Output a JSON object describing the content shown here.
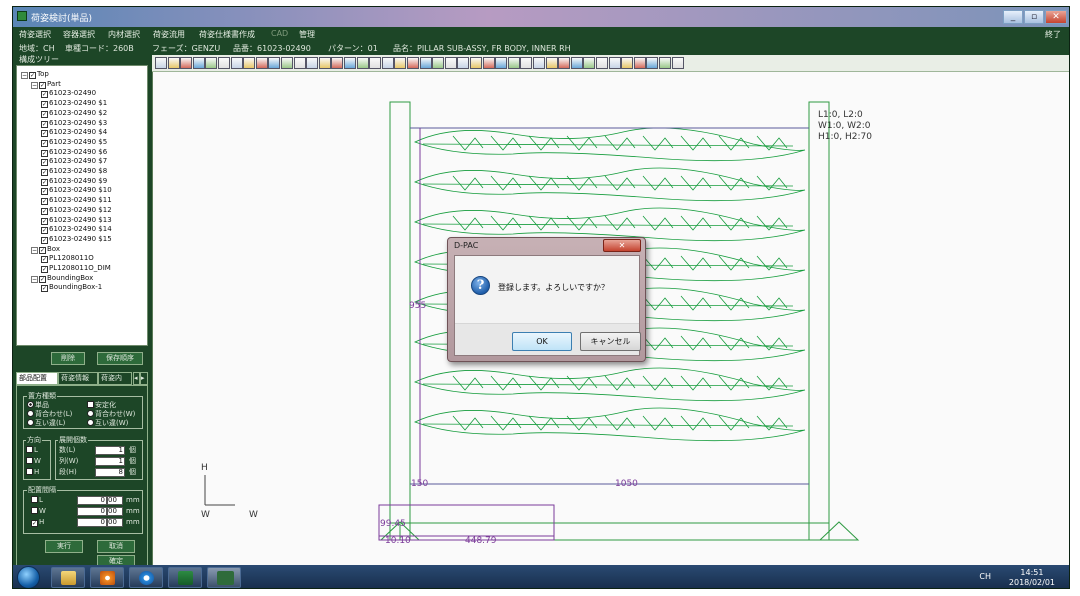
{
  "window": {
    "title": "荷姿検討(単品)",
    "minimize": "_",
    "restore": "▫",
    "close": "✕"
  },
  "menu": [
    "荷姿選択",
    "容器選択",
    "内材選択",
    "荷姿流用",
    "荷姿仕様書作成",
    "CAD",
    "管理"
  ],
  "menu_exit": "終了",
  "info": {
    "region": "地域：CH",
    "car_code": "車種コード：260B",
    "phase": "フェーズ：GENZU",
    "part_no": "品番：61023-02490",
    "pattern": "パターン：01",
    "part_name": "品名：PILLAR SUB-ASSY, FR BODY, INNER RH"
  },
  "tree": {
    "label": "構成ツリー",
    "nodes": [
      {
        "text": "Top",
        "level": 0,
        "expander": "⊟"
      },
      {
        "text": "Part",
        "level": 1,
        "expander": "⊟"
      },
      {
        "text": "61023-02490",
        "level": 2
      },
      {
        "text": "61023-02490 $1",
        "level": 2
      },
      {
        "text": "61023-02490 $2",
        "level": 2
      },
      {
        "text": "61023-02490 $3",
        "level": 2
      },
      {
        "text": "61023-02490 $4",
        "level": 2
      },
      {
        "text": "61023-02490 $5",
        "level": 2
      },
      {
        "text": "61023-02490 $6",
        "level": 2
      },
      {
        "text": "61023-02490 $7",
        "level": 2
      },
      {
        "text": "61023-02490 $8",
        "level": 2
      },
      {
        "text": "61023-02490 $9",
        "level": 2
      },
      {
        "text": "61023-02490 $10",
        "level": 2
      },
      {
        "text": "61023-02490 $11",
        "level": 2
      },
      {
        "text": "61023-02490 $12",
        "level": 2
      },
      {
        "text": "61023-02490 $13",
        "level": 2
      },
      {
        "text": "61023-02490 $14",
        "level": 2
      },
      {
        "text": "61023-02490 $15",
        "level": 2
      },
      {
        "text": "Box",
        "level": 1,
        "expander": "⊟"
      },
      {
        "text": "PL1208011O",
        "level": 2
      },
      {
        "text": "PL1208011O_DIM",
        "level": 2
      },
      {
        "text": "BoundingBox",
        "level": 1,
        "expander": "⊟"
      },
      {
        "text": "BoundingBox-1",
        "level": 2
      }
    ],
    "btn_delete": "削除",
    "btn_save_order": "保存順序"
  },
  "tabs": [
    "部品配置",
    "荷姿情報",
    "荷姿内"
  ],
  "placement": {
    "group1": "置方種類",
    "opt_single": "単品",
    "opt_stabilize": "安定化",
    "opt_stack_l": "背合わせ(L)",
    "opt_stack_w": "背合わせ(W)",
    "opt_alt_l": "互い違(L)",
    "opt_alt_w": "互い違(W)",
    "group2": "方向",
    "group3": "展開個数",
    "dirs": [
      "L",
      "W",
      "H"
    ],
    "counts": [
      {
        "label": "数(L)",
        "value": "1",
        "unit": "個"
      },
      {
        "label": "列(W)",
        "value": "1",
        "unit": "個"
      },
      {
        "label": "段(H)",
        "value": "8",
        "unit": "個"
      }
    ],
    "group4": "配置間隔",
    "gaps": [
      {
        "label": "L",
        "int": "0",
        "dec": "00",
        "unit": "mm"
      },
      {
        "label": "W",
        "int": "0",
        "dec": "00",
        "unit": "mm"
      },
      {
        "label": "H",
        "int": "0",
        "dec": "00",
        "unit": "mm"
      }
    ],
    "btn_run": "実行",
    "btn_cancel": "取消",
    "btn_confirm": "確定"
  },
  "canvas": {
    "dims_text": [
      "L1:0, L2:0",
      "W1:0, W2:0",
      "H1:0, H2:70"
    ],
    "dim_955": "955",
    "dim_150": "150",
    "dim_1050": "1050",
    "dim_99": "99.45",
    "dim_448": "448.79",
    "dim_10": "10.10",
    "axis_h": "H",
    "axis_w1": "W",
    "axis_w2": "W",
    "part_color": "#159c3c",
    "box_color": "#2e9a42",
    "dim_color": "#7b3b99"
  },
  "dialog": {
    "title": "D-PAC",
    "close": "✕",
    "message": "登録します。よろしいですか？",
    "ok": "OK",
    "cancel": "キャンセル"
  },
  "taskbar": {
    "tray": "CH",
    "time": "14:51",
    "date": "2018/02/01",
    "apps": [
      "file-explorer",
      "media-player",
      "internet-explorer",
      "excel",
      "d-pac"
    ]
  }
}
